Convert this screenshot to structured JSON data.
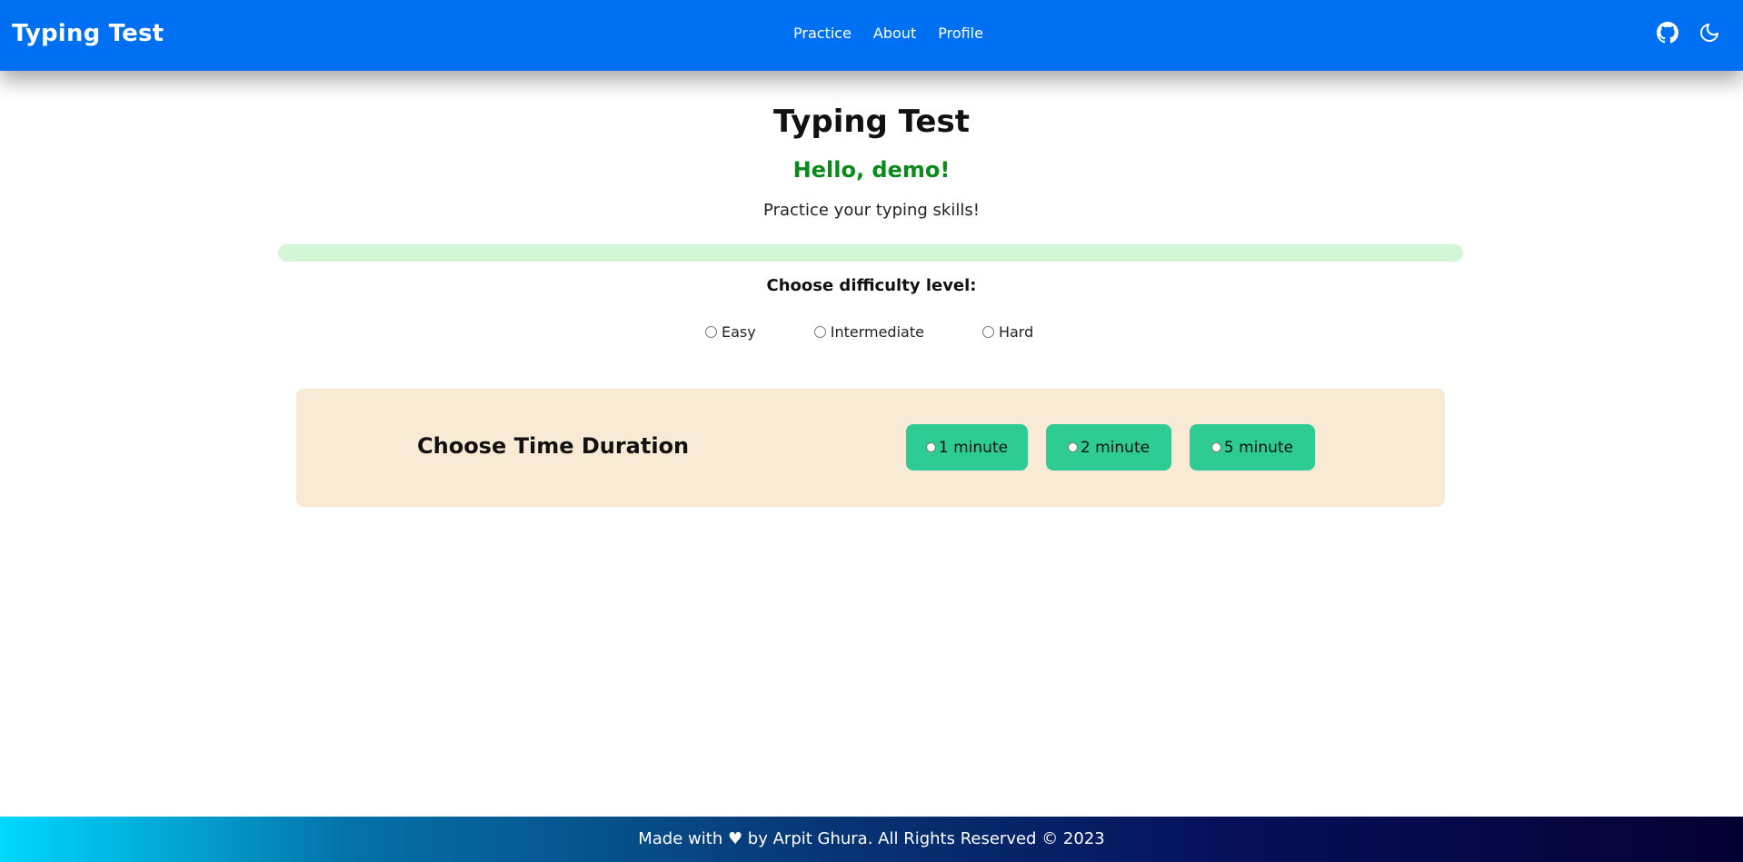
{
  "navbar": {
    "brand": "Typing Test",
    "links": [
      "Practice",
      "About",
      "Profile"
    ],
    "icons": [
      "github-icon",
      "moon-icon"
    ]
  },
  "main": {
    "title": "Typing Test",
    "greeting": "Hello, demo!",
    "subtitle": "Practice your typing skills!",
    "progress": 0,
    "difficulty": {
      "label": "Choose difficulty level:",
      "options": [
        "Easy",
        "Intermediate",
        "Hard"
      ]
    },
    "duration": {
      "title": "Choose Time Duration",
      "options": [
        "1 minute",
        "2 minute",
        "5 minute"
      ]
    }
  },
  "footer": {
    "text": "Made with ♥ by Arpit Ghura. All Rights Reserved © 2023"
  },
  "colors": {
    "navbar": "#0070f3",
    "greeting": "#0a8a1a",
    "progress_track": "#d3f6d6",
    "duration_card": "#f9ead6",
    "duration_button": "#2fcb95"
  }
}
